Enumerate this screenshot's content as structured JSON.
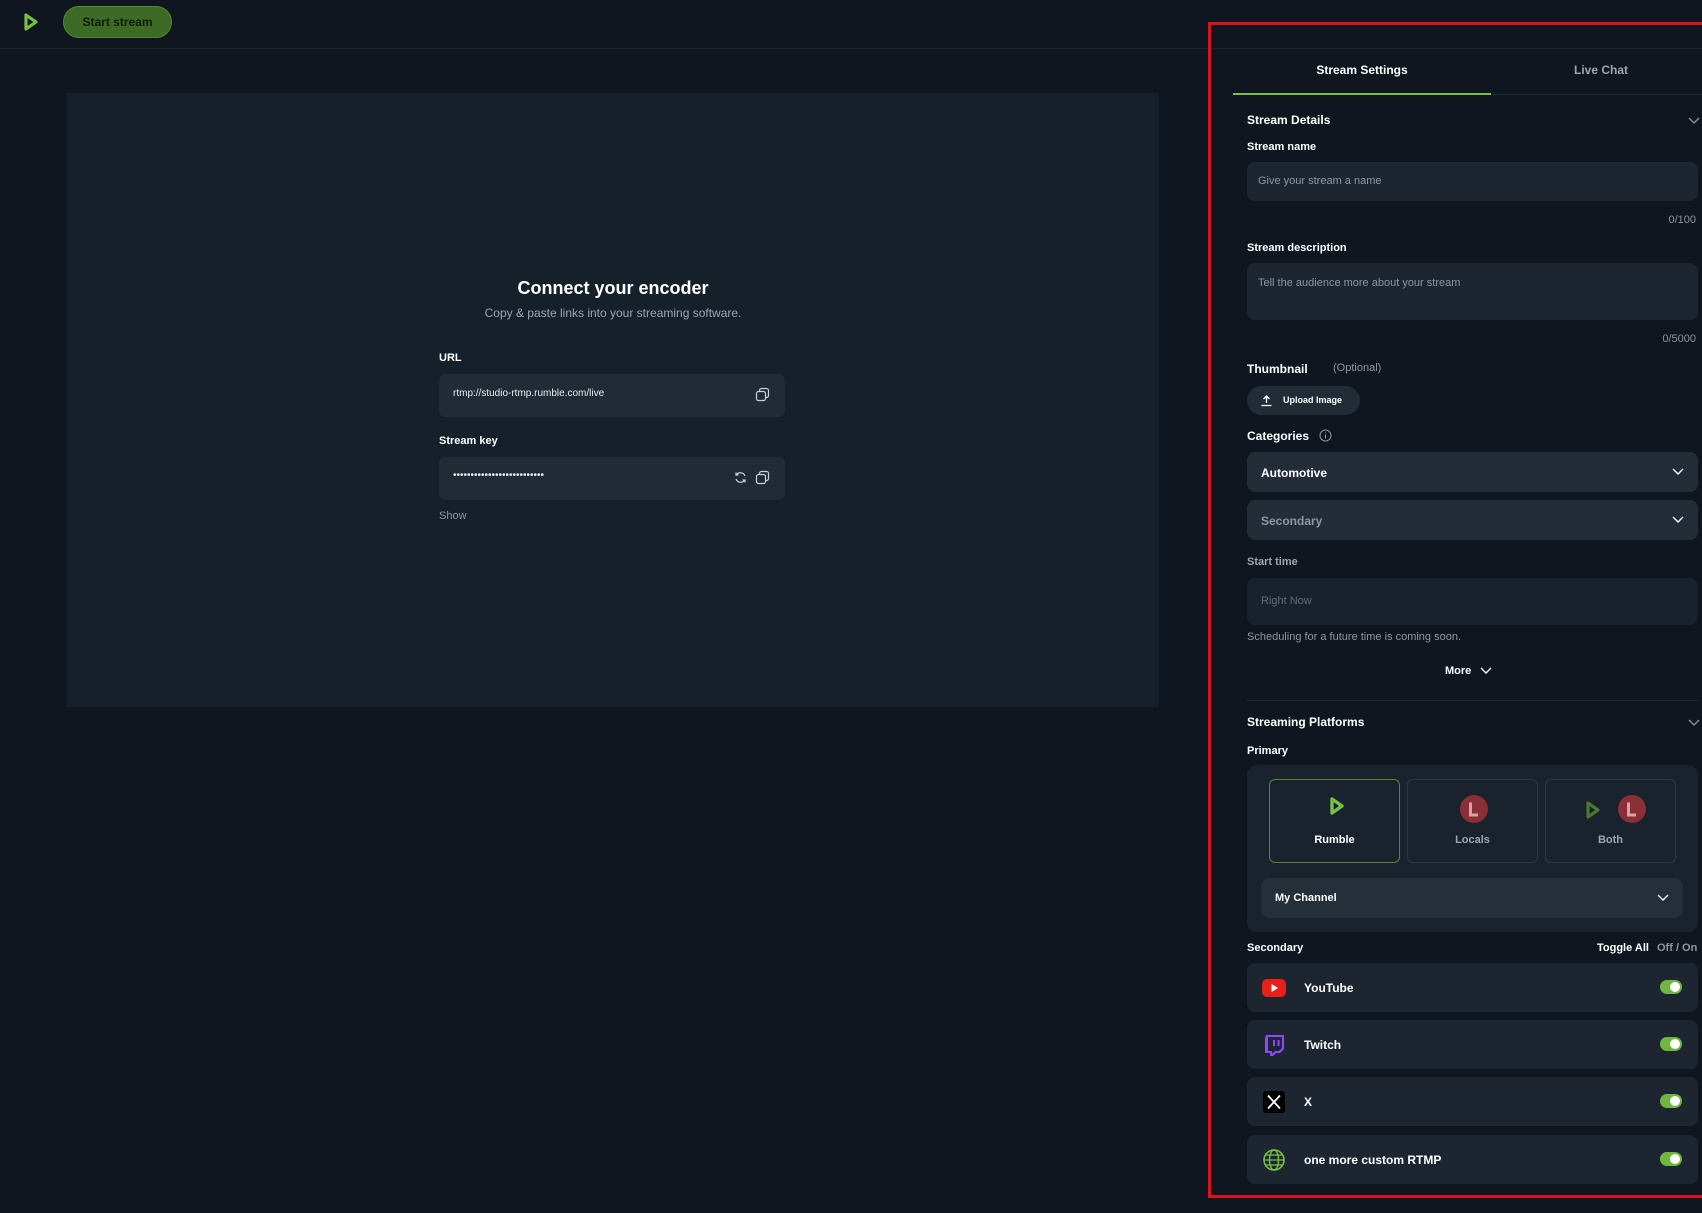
{
  "topbar": {
    "start_stream": "Start stream"
  },
  "encoder": {
    "title": "Connect your encoder",
    "subtitle": "Copy & paste links into your streaming software.",
    "url_label": "URL",
    "url_value": "rtmp://studio-rtmp.rumble.com/live",
    "key_label": "Stream key",
    "key_value": "••••••••••••••••••••••••••",
    "show": "Show"
  },
  "panel": {
    "tabs": {
      "settings": "Stream Settings",
      "chat": "Live Chat"
    },
    "details": {
      "title": "Stream Details",
      "name_label": "Stream name",
      "name_placeholder": "Give your stream a name",
      "name_counter": "0/100",
      "desc_label": "Stream description",
      "desc_placeholder": "Tell the audience more about your stream",
      "desc_counter": "0/5000",
      "thumb_label": "Thumbnail",
      "thumb_optional": "(Optional)",
      "upload": "Upload Image",
      "categories_label": "Categories",
      "category_primary": "Automotive",
      "category_secondary": "Secondary",
      "start_label": "Start time",
      "start_placeholder": "Right Now",
      "schedule_note": "Scheduling for a future time is coming soon.",
      "more": "More"
    },
    "platforms": {
      "title": "Streaming Platforms",
      "primary_label": "Primary",
      "options": [
        "Rumble",
        "Locals",
        "Both"
      ],
      "selected": "Rumble",
      "channel": "My Channel",
      "secondary_label": "Secondary",
      "toggle_all": "Toggle All",
      "off_on": "Off / On",
      "secondary": [
        {
          "name": "YouTube",
          "icon": "youtube-icon",
          "enabled": true
        },
        {
          "name": "Twitch",
          "icon": "twitch-icon",
          "enabled": true
        },
        {
          "name": "X",
          "icon": "x-icon",
          "enabled": true
        },
        {
          "name": "one more custom RTMP",
          "icon": "globe-icon",
          "enabled": true
        }
      ]
    }
  },
  "colors": {
    "accent": "#76c043",
    "highlight": "#d9121b",
    "locals": "#8a2f35"
  }
}
